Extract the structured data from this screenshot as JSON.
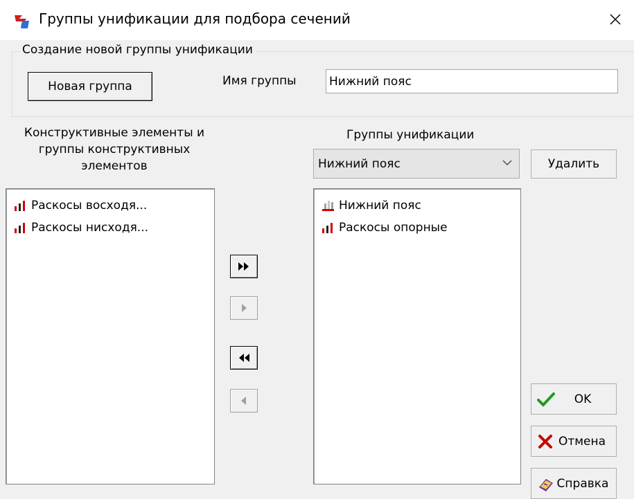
{
  "window": {
    "title": "Группы унификации для подбора сечений",
    "close_glyph": "✕"
  },
  "create_group": {
    "legend": "Создание новой группы унификации",
    "new_group_button": "Новая группа",
    "name_label": "Имя группы",
    "name_value": "Нижний пояс"
  },
  "left_panel": {
    "heading_line1": "Конструктивные элементы и",
    "heading_line2": "группы конструктивных",
    "heading_line3": "элементов",
    "items": [
      {
        "label": "Раскосы восходя...",
        "icon": "element-bars-icon"
      },
      {
        "label": "Раскосы нисходя...",
        "icon": "element-bars-icon"
      }
    ]
  },
  "right_panel": {
    "heading": "Группы унификации",
    "selected_group": "Нижний пояс",
    "delete_button": "Удалить",
    "items": [
      {
        "label": "Нижний пояс",
        "icon": "group-ruler-icon"
      },
      {
        "label": "Раскосы опорные",
        "icon": "element-bars-icon"
      }
    ]
  },
  "transfer_buttons": {
    "move_all_right": "move-all-right-icon",
    "move_right": "move-right-icon",
    "move_all_left": "move-all-left-icon",
    "move_left": "move-left-icon"
  },
  "actions": {
    "ok_label": "OK",
    "cancel_label": "Отмена",
    "help_label": "Справка"
  },
  "colors": {
    "ok_check": "#1e9b1e",
    "cancel_x": "#c80000",
    "icon_red": "#d00000",
    "icon_dark": "#202020",
    "help_book": "#6a2fa0"
  }
}
